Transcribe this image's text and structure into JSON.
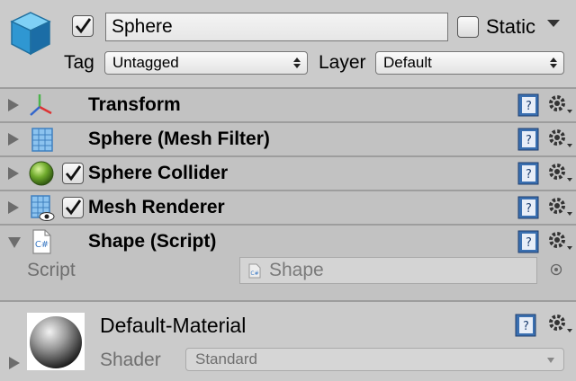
{
  "gameobject": {
    "icon": "cube-icon",
    "active": true,
    "name": "Sphere",
    "static_label": "Static",
    "static_checked": false,
    "tag_label": "Tag",
    "tag_value": "Untagged",
    "layer_label": "Layer",
    "layer_value": "Default"
  },
  "components": [
    {
      "title": "Transform",
      "icon": "transform-axes-icon",
      "expanded": false,
      "has_toggle": false
    },
    {
      "title": "Sphere (Mesh Filter)",
      "icon": "mesh-filter-icon",
      "expanded": false,
      "has_toggle": false
    },
    {
      "title": "Sphere Collider",
      "icon": "sphere-collider-icon",
      "expanded": false,
      "has_toggle": true,
      "enabled": true
    },
    {
      "title": "Mesh Renderer",
      "icon": "mesh-renderer-icon",
      "expanded": false,
      "has_toggle": true,
      "enabled": true
    },
    {
      "title": "Shape (Script)",
      "icon": "csharp-script-icon",
      "expanded": true,
      "has_toggle": false
    }
  ],
  "script_field": {
    "label": "Script",
    "value": "Shape"
  },
  "material": {
    "name": "Default-Material",
    "shader_label": "Shader",
    "shader_value": "Standard"
  },
  "colors": {
    "panel": "#c2c2c2",
    "header": "#cbcbcb",
    "help_blue": "#3a6fb0"
  }
}
